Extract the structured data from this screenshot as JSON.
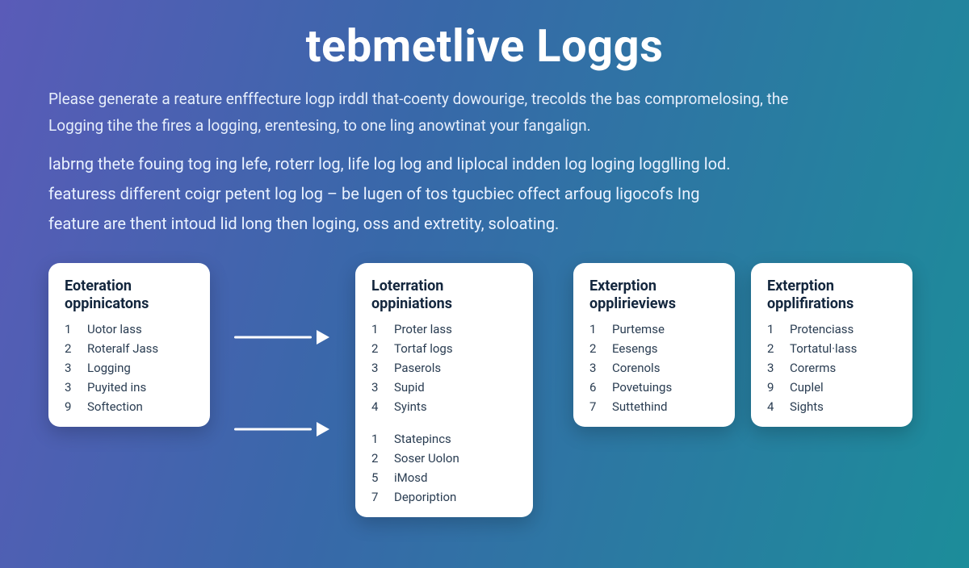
{
  "title": "tebmetlive Loggs",
  "intro": {
    "line1": "Please generate a reature enfffecture logp irddl that-coenty dowourige, trecolds the bas compromelosing, the",
    "line2": "Logging tihe the fires a logging, erentesing, to one ling anowtinat your fangalign."
  },
  "desc": {
    "line1": "labrng thete fouing tog ing lefe, roterr log, life log log and liplocal indden log loging logglling lod.",
    "line2": "featuress different coigr petent log log – be lugen of tos tgucbiec offect arfoug ligocofs Ing",
    "line3": "feature are thent intoud lid long then loging, oss and extretity, soloating."
  },
  "cards": [
    {
      "title": "Eoteration oppinicatons",
      "items": [
        {
          "n": "1",
          "t": "Uotor lass"
        },
        {
          "n": "2",
          "t": "Roteralf Jass"
        },
        {
          "n": "3",
          "t": "Logging"
        },
        {
          "n": "3",
          "t": "Puyited ins"
        },
        {
          "n": "9",
          "t": "Softection"
        }
      ]
    },
    {
      "title": "Loterration oppiniations",
      "groupA": [
        {
          "n": "1",
          "t": "Proter lass"
        },
        {
          "n": "2",
          "t": "Tortaf logs"
        },
        {
          "n": "3",
          "t": "Paserols"
        },
        {
          "n": "3",
          "t": "Supid"
        },
        {
          "n": "4",
          "t": "Syints"
        }
      ],
      "groupB": [
        {
          "n": "1",
          "t": "Statepincs"
        },
        {
          "n": "2",
          "t": "Soser Uolon"
        },
        {
          "n": "5",
          "t": "iMosd"
        },
        {
          "n": "7",
          "t": "Depoription"
        }
      ]
    },
    {
      "title": "Exterption opplirieviews",
      "items": [
        {
          "n": "1",
          "t": "Purtemse"
        },
        {
          "n": "2",
          "t": "Eesengs"
        },
        {
          "n": "3",
          "t": "Corenols"
        },
        {
          "n": "6",
          "t": "Povetuings"
        },
        {
          "n": "7",
          "t": "Suttethind"
        }
      ]
    },
    {
      "title": "Exterption opplifirations",
      "items": [
        {
          "n": "1",
          "t": "Protenciass"
        },
        {
          "n": "2",
          "t": "Tortatul·lass"
        },
        {
          "n": "3",
          "t": "Corerms"
        },
        {
          "n": "9",
          "t": "Cuplel"
        },
        {
          "n": "4",
          "t": "Sights"
        }
      ]
    }
  ]
}
